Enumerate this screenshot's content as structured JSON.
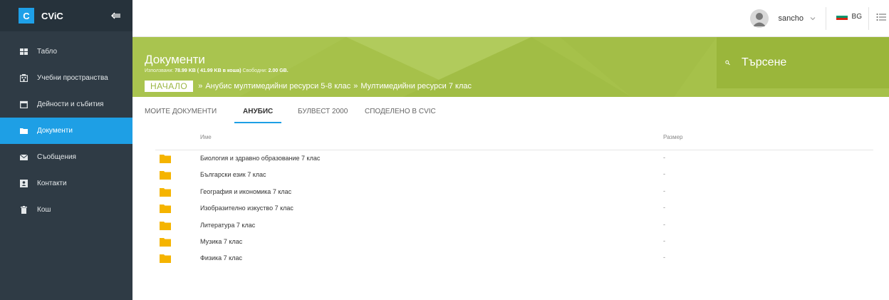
{
  "app": {
    "logo_letter": "C",
    "name": "CViC"
  },
  "sidebar": {
    "items": [
      {
        "label": "Табло",
        "icon": "dashboard-icon"
      },
      {
        "label": "Учебни пространства",
        "icon": "building-icon"
      },
      {
        "label": "Дейности и събития",
        "icon": "calendar-icon"
      },
      {
        "label": "Документи",
        "icon": "folder-icon",
        "active": true
      },
      {
        "label": "Съобщения",
        "icon": "mail-icon"
      },
      {
        "label": "Контакти",
        "icon": "contact-card-icon"
      },
      {
        "label": "Кош",
        "icon": "trash-icon"
      }
    ]
  },
  "topbar": {
    "username": "sancho",
    "language": "BG"
  },
  "header": {
    "title": "Документи",
    "usage": {
      "used_label": "Използвани:",
      "used_value": "78.99 KB ( 41.99 KB в коша)",
      "free_label": "Свободни:",
      "free_value": "2.00 GB."
    },
    "breadcrumb": {
      "home": "НАЧАЛО",
      "sep": "»",
      "items": [
        "Анубис мултимедийни ресурси 5-8 клас",
        "Мултимедийни ресурси 7 клас"
      ]
    },
    "search_placeholder": "Търсене"
  },
  "tabs": [
    {
      "label": "МОИТЕ ДОКУМЕНТИ"
    },
    {
      "label": "АНУБИС",
      "active": true
    },
    {
      "label": "БУЛВЕСТ 2000"
    },
    {
      "label": "СПОДЕЛЕНО В CVIC"
    }
  ],
  "table": {
    "columns": {
      "name": "Име",
      "size": "Размер"
    },
    "rows": [
      {
        "name": "Биология и здравно образование 7 клас",
        "size": "-"
      },
      {
        "name": "Български език 7 клас",
        "size": "-"
      },
      {
        "name": "География и икономика 7 клас",
        "size": "-"
      },
      {
        "name": "Изобразително изкуство 7 клас",
        "size": "-"
      },
      {
        "name": "Литература 7 клас",
        "size": "-"
      },
      {
        "name": "Музика 7 клас",
        "size": "-"
      },
      {
        "name": "Физика 7 клас",
        "size": "-"
      }
    ]
  },
  "colors": {
    "sidebar": "#2f3b45",
    "accent": "#1e9fe5",
    "banner": "#a6c14a",
    "folder": "#f5b400"
  }
}
